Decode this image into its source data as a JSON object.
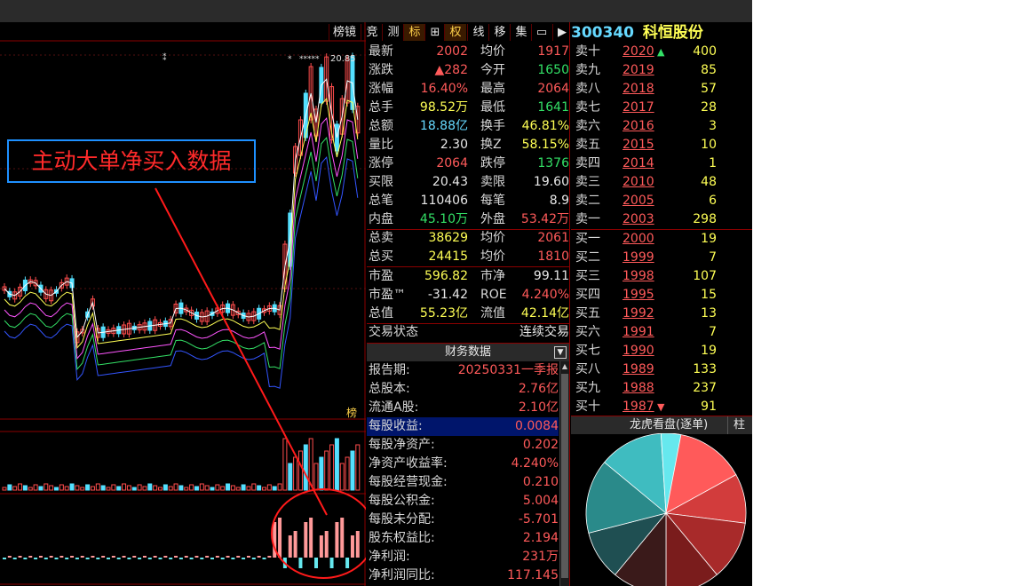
{
  "toolbar": {
    "buttons": [
      "榜镜",
      "竞",
      "测",
      "标",
      "⊞",
      "权",
      "线",
      "移",
      "集",
      "▭",
      "▶"
    ],
    "active": "标",
    "right_marker": "权"
  },
  "stock": {
    "code": "300340",
    "name": "科恒股份"
  },
  "chart": {
    "max_label": "20.85",
    "max_stars": "*****",
    "top_star": "*",
    "small_top_mark": "⁑",
    "indicator_tab": "榜",
    "annotation_text": "主动大单净买入数据"
  },
  "quote": {
    "rows": [
      {
        "l1": "最新",
        "v1": "2002",
        "c1": "red",
        "l2": "均价",
        "v2": "1917",
        "c2": "red"
      },
      {
        "l1": "涨跌",
        "v1": "▲282",
        "c1": "red",
        "l2": "今开",
        "v2": "1650",
        "c2": "green"
      },
      {
        "l1": "涨幅",
        "v1": "16.40%",
        "c1": "red",
        "l2": "最高",
        "v2": "2064",
        "c2": "red"
      },
      {
        "l1": "总手",
        "v1": "98.52万",
        "c1": "yellow",
        "l2": "最低",
        "v2": "1641",
        "c2": "green"
      },
      {
        "l1": "总额",
        "v1": "18.88亿",
        "c1": "cyan",
        "l2": "换手",
        "v2": "46.81%",
        "c2": "yellow"
      },
      {
        "l1": "量比",
        "v1": "2.30",
        "c1": "white",
        "l2": "换Z",
        "v2": "58.15%",
        "c2": "yellow"
      },
      {
        "l1": "涨停",
        "v1": "2064",
        "c1": "red",
        "l2": "跌停",
        "v2": "1376",
        "c2": "green"
      },
      {
        "l1": "买限",
        "v1": "20.43",
        "c1": "white",
        "l2": "卖限",
        "v2": "19.60",
        "c2": "white"
      },
      {
        "l1": "总笔",
        "v1": "110406",
        "c1": "white",
        "l2": "每笔",
        "v2": "8.9",
        "c2": "white"
      },
      {
        "l1": "内盘",
        "v1": "45.10万",
        "c1": "green",
        "l2": "外盘",
        "v2": "53.42万",
        "c2": "red"
      }
    ],
    "rows2": [
      {
        "l1": "总卖",
        "v1": "38629",
        "c1": "yellow",
        "l2": "均价",
        "v2": "2061",
        "c2": "red"
      },
      {
        "l1": "总买",
        "v1": "24415",
        "c1": "yellow",
        "l2": "均价",
        "v2": "1810",
        "c2": "red"
      }
    ],
    "rows3": [
      {
        "l1": "市盈",
        "v1": "596.82",
        "c1": "yellow",
        "l2": "市净",
        "v2": "99.11",
        "c2": "white"
      },
      {
        "l1": "市盈™",
        "v1": "-31.42",
        "c1": "white",
        "l2": "ROE",
        "v2": "4.240%",
        "c2": "red"
      },
      {
        "l1": "总值",
        "v1": "55.23亿",
        "c1": "yellow",
        "l2": "流值",
        "v2": "42.14亿",
        "c2": "yellow"
      }
    ],
    "pe_badge": "①",
    "trade_status_label": "交易状态",
    "trade_status_value": "连续交易"
  },
  "finance": {
    "title": "财务数据",
    "rows": [
      {
        "label": "报告期:",
        "value": "20250331一季报",
        "highlight": false
      },
      {
        "label": "总股本:",
        "value": "2.76亿",
        "highlight": false
      },
      {
        "label": "流通A股:",
        "value": "2.10亿",
        "highlight": false
      },
      {
        "label": "每股收益:",
        "value": "0.0084",
        "highlight": true
      },
      {
        "label": "每股净资产:",
        "value": "0.202",
        "highlight": false
      },
      {
        "label": "净资产收益率:",
        "value": "4.240%",
        "highlight": false
      },
      {
        "label": "每股经营现金:",
        "value": "0.210",
        "highlight": false
      },
      {
        "label": "每股公积金:",
        "value": "5.004",
        "highlight": false
      },
      {
        "label": "每股未分配:",
        "value": "-5.701",
        "highlight": false
      },
      {
        "label": "股东权益比:",
        "value": "2.194",
        "highlight": false
      },
      {
        "label": "净利润:",
        "value": "231万",
        "highlight": false
      },
      {
        "label": "净利润同比:",
        "value": "117.145",
        "highlight": false
      }
    ]
  },
  "orderbook": {
    "asks": [
      {
        "label": "卖十",
        "price": "2020",
        "vol": "400",
        "arrow": "▲"
      },
      {
        "label": "卖九",
        "price": "2019",
        "vol": "85",
        "arrow": ""
      },
      {
        "label": "卖八",
        "price": "2018",
        "vol": "57",
        "arrow": ""
      },
      {
        "label": "卖七",
        "price": "2017",
        "vol": "28",
        "arrow": ""
      },
      {
        "label": "卖六",
        "price": "2016",
        "vol": "3",
        "arrow": ""
      },
      {
        "label": "卖五",
        "price": "2015",
        "vol": "10",
        "arrow": ""
      },
      {
        "label": "卖四",
        "price": "2014",
        "vol": "1",
        "arrow": ""
      },
      {
        "label": "卖三",
        "price": "2010",
        "vol": "48",
        "arrow": ""
      },
      {
        "label": "卖二",
        "price": "2005",
        "vol": "6",
        "arrow": ""
      },
      {
        "label": "卖一",
        "price": "2003",
        "vol": "298",
        "arrow": ""
      }
    ],
    "bids": [
      {
        "label": "买一",
        "price": "2000",
        "vol": "19",
        "arrow": ""
      },
      {
        "label": "买二",
        "price": "1999",
        "vol": "7",
        "arrow": ""
      },
      {
        "label": "买三",
        "price": "1998",
        "vol": "107",
        "arrow": ""
      },
      {
        "label": "买四",
        "price": "1995",
        "vol": "15",
        "arrow": ""
      },
      {
        "label": "买五",
        "price": "1992",
        "vol": "13",
        "arrow": ""
      },
      {
        "label": "买六",
        "price": "1991",
        "vol": "7",
        "arrow": ""
      },
      {
        "label": "买七",
        "price": "1990",
        "vol": "19",
        "arrow": ""
      },
      {
        "label": "买八",
        "price": "1989",
        "vol": "133",
        "arrow": ""
      },
      {
        "label": "买九",
        "price": "1988",
        "vol": "237",
        "arrow": ""
      },
      {
        "label": "买十",
        "price": "1987",
        "vol": "91",
        "arrow": "▼"
      }
    ]
  },
  "dragon": {
    "title": "龙虎看盘(逐单)",
    "tab": "柱",
    "slice_colors": [
      "#ff5a5a",
      "#d23c3c",
      "#a82a2a",
      "#7a1c1c",
      "#3a1a1a",
      "#1f4f52",
      "#2a8a8a",
      "#3fbcc0",
      "#66e8ee"
    ]
  }
}
